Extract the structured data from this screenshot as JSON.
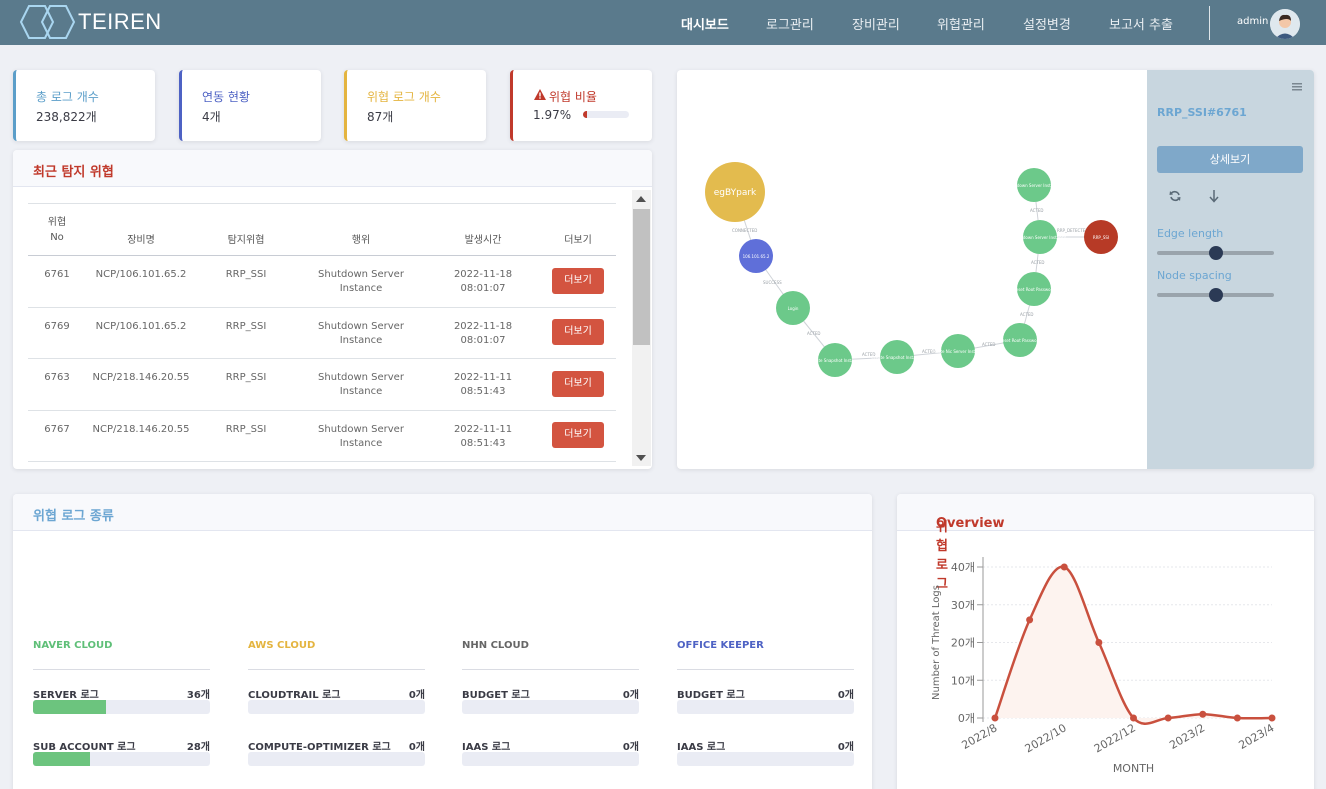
{
  "brand": {
    "name": "TEIREN"
  },
  "nav": {
    "items": [
      "대시보드",
      "로그관리",
      "장비관리",
      "위협관리",
      "설정변경",
      "보고서 추출"
    ],
    "active": "대시보드"
  },
  "user": {
    "name": "admin"
  },
  "stats": [
    {
      "label": "총 로그 개수",
      "value": "238,822개",
      "color": "#5b9ec9"
    },
    {
      "label": "연동 현황",
      "value": "4개",
      "color": "#4e62c4"
    },
    {
      "label": "위협 로그 개수",
      "value": "87개",
      "color": "#e4b43f"
    },
    {
      "label": "위협 비율",
      "value": "1.97%",
      "color": "#c0392b",
      "progress": 0.0197
    }
  ],
  "recent": {
    "title": "최근 탐지 위협",
    "headers": [
      "위협\nNo",
      "장비명",
      "탐지위협",
      "행위",
      "발생시간",
      "더보기"
    ],
    "rows": [
      {
        "no": "6761",
        "device": "NCP/106.101.65.2",
        "threat": "RRP_SSI",
        "action": "Shutdown Server\nInstance",
        "time": "2022-11-18\n08:01:07",
        "btn": "더보기"
      },
      {
        "no": "6769",
        "device": "NCP/106.101.65.2",
        "threat": "RRP_SSI",
        "action": "Shutdown Server\nInstance",
        "time": "2022-11-18\n08:01:07",
        "btn": "더보기"
      },
      {
        "no": "6763",
        "device": "NCP/218.146.20.55",
        "threat": "RRP_SSI",
        "action": "Shutdown Server\nInstance",
        "time": "2022-11-11\n08:51:43",
        "btn": "더보기"
      },
      {
        "no": "6767",
        "device": "NCP/218.146.20.55",
        "threat": "RRP_SSI",
        "action": "Shutdown Server\nInstance",
        "time": "2022-11-11\n08:51:43",
        "btn": "더보기"
      }
    ]
  },
  "graph": {
    "panel_title": "RRP_SSI#6761",
    "detail_button": "상세보기",
    "edge_length_label": "Edge length",
    "node_spacing_label": "Node spacing",
    "edge_length_value": 0.5,
    "node_spacing_value": 0.5,
    "nodes": [
      "egBYpark",
      "106.101.65.2",
      "Login",
      "Create Snapshot Instance",
      "Create Snapshot Instance",
      "Create Nic Server Instance",
      "Reset Root Password",
      "Reset Root Password",
      "Shutdown Server Instance",
      "Shutdown Server Instance",
      "RRP_SSI"
    ],
    "edges": [
      "CONNECTED",
      "SUCCESS",
      "ACTED",
      "ACTED",
      "ACTED",
      "ACTED",
      "ACTED",
      "ACTED",
      "ACTED",
      "RRP_DETECTED"
    ]
  },
  "log_types": {
    "title": "위협 로그 종류",
    "groups": [
      {
        "name": "NAVER CLOUD",
        "color": "#5fbf78",
        "items": [
          {
            "label": "SERVER 로그",
            "value": "36개",
            "ratio": 0.41
          },
          {
            "label": "SUB ACCOUNT 로그",
            "value": "28개",
            "ratio": 0.32
          }
        ]
      },
      {
        "name": "AWS CLOUD",
        "color": "#e4b43f",
        "items": [
          {
            "label": "CLOUDTRAIL 로그",
            "value": "0개",
            "ratio": 0
          },
          {
            "label": "COMPUTE-OPTIMIZER 로그",
            "value": "0개",
            "ratio": 0
          }
        ]
      },
      {
        "name": "NHN CLOUD",
        "color": "#666666",
        "items": [
          {
            "label": "BUDGET 로그",
            "value": "0개",
            "ratio": 0
          },
          {
            "label": "IAAS 로그",
            "value": "0개",
            "ratio": 0
          }
        ]
      },
      {
        "name": "OFFICE KEEPER",
        "color": "#4e62c4",
        "items": [
          {
            "label": "BUDGET 로그",
            "value": "0개",
            "ratio": 0
          },
          {
            "label": "IAAS 로그",
            "value": "0개",
            "ratio": 0
          }
        ]
      }
    ]
  },
  "overview": {
    "title_ko": "위협 로그",
    "title_en": "Overview"
  },
  "chart_data": {
    "type": "line",
    "x": [
      "2022/8",
      "2022/9",
      "2022/10",
      "2022/11",
      "2022/12",
      "2023/1",
      "2023/2",
      "2023/3",
      "2023/4"
    ],
    "x_tick_labels": [
      "2022/8",
      "2022/10",
      "2022/12",
      "2023/2",
      "2023/4"
    ],
    "values": [
      0,
      26,
      40,
      20,
      0,
      0,
      1,
      0,
      0
    ],
    "y_ticks": [
      "0개",
      "10개",
      "20개",
      "30개",
      "40개"
    ],
    "ylim": [
      0,
      40
    ],
    "xlabel": "MONTH",
    "ylabel": "Number of Threat Logs",
    "grid": true,
    "line_color": "#c9503e"
  }
}
